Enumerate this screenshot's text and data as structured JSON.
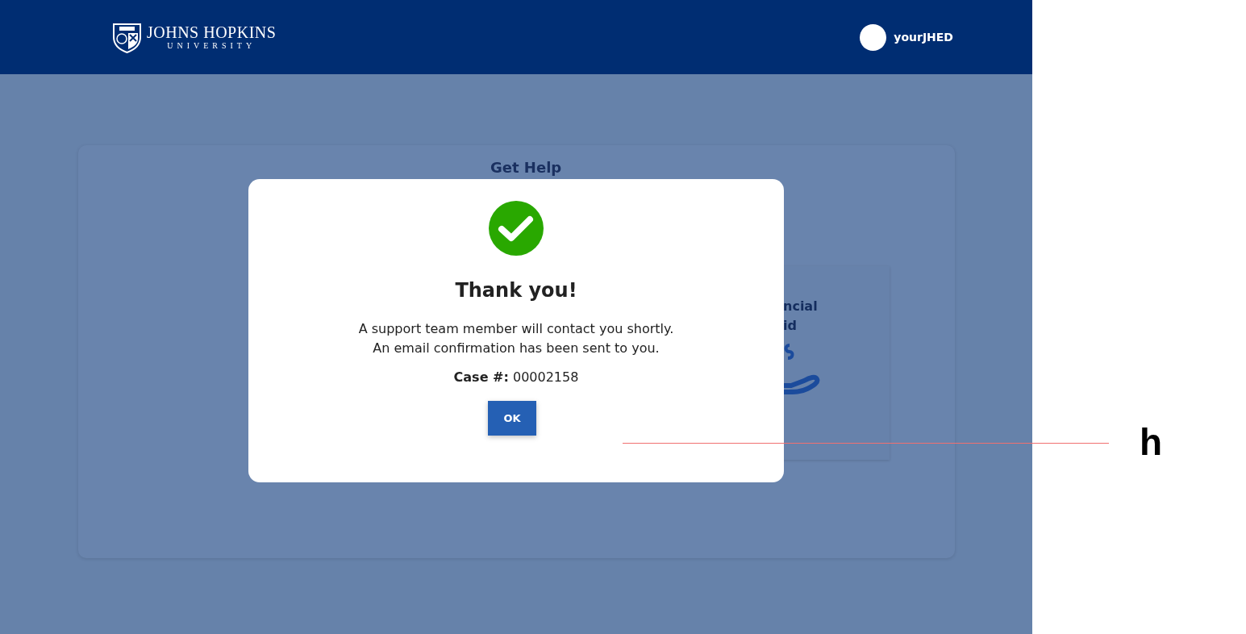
{
  "header": {
    "logo_name": "JOHNS HOPKINS",
    "logo_subtitle": "UNIVERSITY",
    "user_label": "yourJHED"
  },
  "page": {
    "card_title": "Get Help",
    "tile": {
      "lines": [
        "ncial",
        "id"
      ]
    }
  },
  "dialog": {
    "title": "Thank you!",
    "message_lines": [
      "A support team member will contact you shortly.",
      "An email confirmation has been sent to you."
    ],
    "case_line": "**Case #:** 00002158",
    "button": "OK"
  },
  "annotation": {
    "label": "h"
  }
}
